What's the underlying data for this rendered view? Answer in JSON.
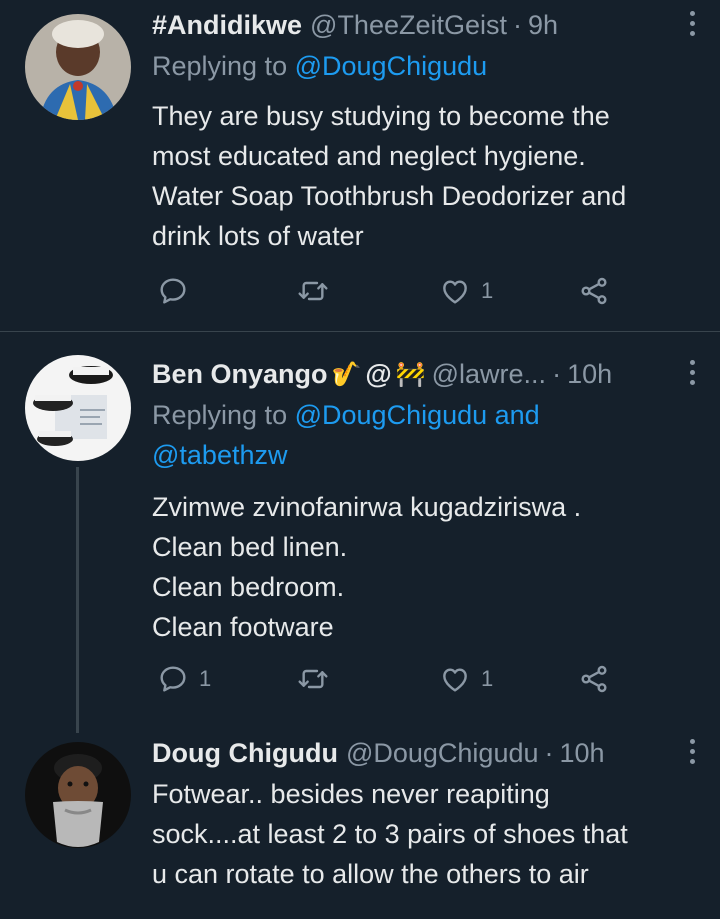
{
  "tweets": [
    {
      "name": "#Andidikwe",
      "handle": "@TheeZeitGeist",
      "dot": "·",
      "time": "9h",
      "replying_prefix": "Replying to",
      "replying_to": "@DougChigudu",
      "text_lines": [
        "They are busy studying to become the",
        "most educated and neglect hygiene.",
        "Water Soap Toothbrush Deodorizer and",
        "drink lots of water"
      ],
      "replies": "",
      "retweets": "",
      "likes": "1"
    },
    {
      "name": "Ben Onyango",
      "name_suffix": "@",
      "handle": "@lawre...",
      "dot": "·",
      "time": "10h",
      "replying_prefix": "Replying to",
      "replying_to": "@DougChigudu and",
      "replying_to_2": "@tabethzw",
      "text_lines": [
        "Zvimwe zvinofanirwa kugadziriswa .",
        "Clean bed linen.",
        "Clean bedroom.",
        "Clean footware"
      ],
      "replies": "1",
      "retweets": "",
      "likes": "1"
    },
    {
      "name": "Doug Chigudu",
      "handle": "@DougChigudu",
      "dot": "·",
      "time": "10h",
      "text_lines": [
        "Fotwear.. besides never reapiting",
        "sock....at least 2 to 3 pairs of shoes that",
        "u can rotate to allow the others to air"
      ]
    }
  ],
  "colors": {
    "background": "#15202b",
    "text": "#e7e9ea",
    "secondary": "#8b98a5",
    "link": "#1d9bf0",
    "divider": "#38444d"
  }
}
